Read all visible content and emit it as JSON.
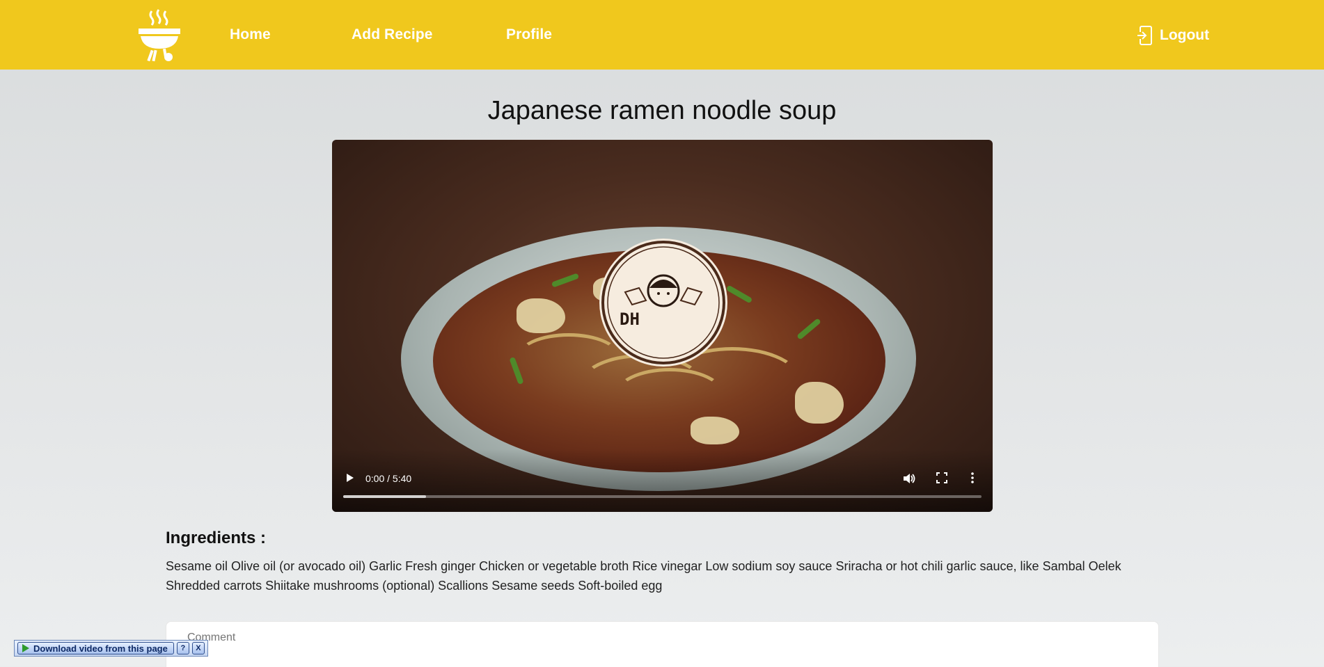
{
  "nav": {
    "home": "Home",
    "add_recipe": "Add Recipe",
    "profile": "Profile",
    "logout": "Logout"
  },
  "recipe": {
    "title": "Japanese ramen noodle soup",
    "video": {
      "time": "0:00 / 5:40",
      "buffered_fraction": 0.13
    },
    "ingredients_heading": "Ingredients :",
    "ingredients_text": "Sesame oil Olive oil (or avocado oil) Garlic Fresh ginger Chicken or vegetable broth Rice vinegar Low sodium soy sauce Sriracha or hot chili garlic sauce, like Sambal Oelek Shredded carrots Shiitake mushrooms (optional) Scallions Sesame seeds Soft-boiled egg"
  },
  "comment": {
    "placeholder": "Comment"
  },
  "download_bar": {
    "label": "Download video from this page",
    "help": "?",
    "close": "X"
  },
  "badge": {
    "text": "DH"
  },
  "icons": [
    "grill-logo-icon",
    "logout-icon",
    "play-icon",
    "volume-icon",
    "fullscreen-icon",
    "more-options-icon"
  ],
  "colors": {
    "navbar": "#f0c81d",
    "nav_text": "#ffffff",
    "background": "#e2e4e5"
  }
}
